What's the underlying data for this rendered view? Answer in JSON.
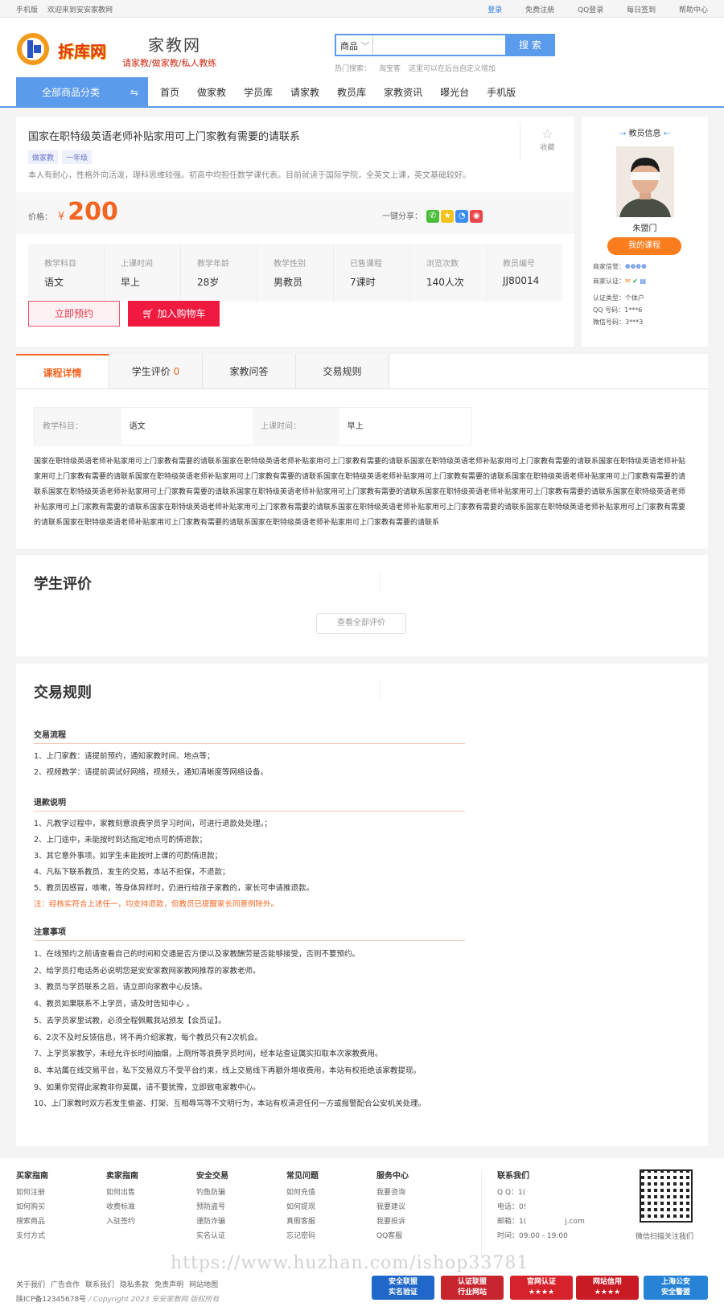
{
  "topbar": {
    "mobile": "手机版",
    "welcome": "欢迎来到安安家教网",
    "links": [
      "登录",
      "免费注册",
      "QQ登录",
      "每日签到",
      "帮助中心"
    ]
  },
  "header": {
    "logo": "拆库网",
    "brand": "家教网",
    "slogan": "请家教/做家教/私人教练"
  },
  "search": {
    "select": "商品",
    "button": "搜 索",
    "hot_label": "热门搜索：",
    "hot": [
      "淘宝客",
      "这里可以在后台自定义增加"
    ]
  },
  "nav": {
    "category": "全部商品分类",
    "items": [
      "首页",
      "做家教",
      "学员库",
      "请家教",
      "教员库",
      "家教资讯",
      "曝光台",
      "手机版"
    ]
  },
  "course": {
    "title": "国家在职特级英语老师补贴家用可上门家教有需要的请联系",
    "fav": "收藏",
    "tags": [
      "做家教",
      "一年级"
    ],
    "desc": "本人有耐心，性格外向活泼，理科思维较强。初高中均担任数学课代表。目前就读于国际学院，全英文上课，英文基础较好。",
    "price_label": "价格：",
    "currency": "¥",
    "price": "200",
    "share_label": "一键分享：",
    "attrs": [
      {
        "k": "教学科目",
        "v": "语文"
      },
      {
        "k": "上课时间",
        "v": "早上"
      },
      {
        "k": "教学年龄",
        "v": "28岁"
      },
      {
        "k": "教学性别",
        "v": "男教员"
      },
      {
        "k": "已售课程",
        "v": "7课时"
      },
      {
        "k": "浏览次数",
        "v": "140人次"
      },
      {
        "k": "教员编号",
        "v": "JJ80014"
      }
    ],
    "book": "立即预约",
    "cart": "加入购物车"
  },
  "teacher": {
    "header": "教员信息",
    "name": "朱盟门",
    "course_btn": "我的课程",
    "credit": "商家信誉：",
    "cert": "商家认证：",
    "type": "认证类型：个体户",
    "qq": "QQ 号码：1***6",
    "wechat": "微信号码：3***3"
  },
  "tabs": [
    {
      "label": "课程详情"
    },
    {
      "label": "学生评价",
      "count": "0"
    },
    {
      "label": "家教问答"
    },
    {
      "label": "交易规则"
    }
  ],
  "detail": {
    "k1": "教学科目：",
    "v1": "语文",
    "k2": "上课时间：",
    "v2": "早上",
    "text": "国家在职特级英语老师补贴家用可上门家教有需要的请联系国家在职特级英语老师补贴家用可上门家教有需要的请联系国家在职特级英语老师补贴家用可上门家教有需要的请联系国家在职特级英语老师补贴家用可上门家教有需要的请联系国家在职特级英语老师补贴家用可上门家教有需要的请联系国家在职特级英语老师补贴家用可上门家教有需要的请联系国家在职特级英语老师补贴家用可上门家教有需要的请联系国家在职特级英语老师补贴家用可上门家教有需要的请联系国家在职特级英语老师补贴家用可上门家教有需要的请联系国家在职特级英语老师补贴家用可上门家教有需要的请联系国家在职特级英语老师补贴家用可上门家教有需要的请联系国家在职特级英语老师补贴家用可上门家教有需要的请联系国家在职特级英语老师补贴家用可上门家教有需要的请联系国家在职特级英语老师补贴家用可上门家教有需要的请联系国家在职特级英语老师补贴家用可上门家教有需要的请联系国家在职特级英语老师补贴家用可上门家教有需要的请联系"
  },
  "reviews": {
    "title": "学生评价",
    "view_all": "查看全部评价"
  },
  "rules": {
    "title": "交易规则",
    "s1": "交易流程",
    "l1": [
      "1、上门家教：请提前预约，通知家教时间、地点等；",
      "2、视频教学：请提前调试好网络，视频头，通知清晰度等网络设备。"
    ],
    "s2": "退款说明",
    "l2": [
      "1、凡教学过程中，家教刻意浪费学员学习时间，可进行退款处处理。；",
      "2、上门途中，未能按时到达指定地点可酌情退款；",
      "3、其它意外事项，如学生未能按时上课的可酌情退款；",
      "4、凡私下联系教员，发生的交易，本站不担保，不退款；",
      "5、教员因感冒，咳嗽，等身体异样时，仍进行给孩子家教的，家长可申请推退款。"
    ],
    "note": "注：经核实符合上述任一，均支持退款，但教员已提醒家长同意例除外。",
    "s3": "注意事项",
    "l3": [
      "1、在线预约之前请查看自己的时间和交通是否方便以及家教酬劳是否能够接受，否则不要预约。",
      "2、给学员打电话务必说明您是安安家教网家教网推荐的家教老师。",
      "3、教员与学员联系之后，请立即向家教中心反馈。",
      "4、教员如果联系不上学员，请及时告知中心 。",
      "5、去学员家里试教，必须全程佩戴我站颁发【会员证】。",
      "6、2次不及时反馈信息，将不再介绍家教，每个教员只有2次机会。",
      "7、上学员家教学，未经允许长时间抽烟，上厕所等浪费学员时间，经本站查证属实扣取本次家教费用。",
      "8、本站属在线交易平台，私下交易双方不受平台约束，线上交易线下再额外增收费用，本站有权拒绝该家教提现。",
      "9、如果你觉得此家教非你莫属，请不要犹豫，立即致电家教中心。",
      "10、上门家教时双方若发生偷盗、打架、互相辱骂等不文明行为，本站有权清退任何一方或报警配合公安机关处理。"
    ]
  },
  "footer": {
    "cols": [
      {
        "h": "买家指南",
        "items": [
          "如何注册",
          "如何购买",
          "搜索商品",
          "支付方式"
        ]
      },
      {
        "h": "卖家指南",
        "items": [
          "如何出售",
          "收费标准",
          "入驻签约"
        ]
      },
      {
        "h": "安全交易",
        "items": [
          "钓鱼防骗",
          "预防盗号",
          "谨防诈骗",
          "实名认证"
        ]
      },
      {
        "h": "常见问题",
        "items": [
          "如何充值",
          "如何提现",
          "真假客服",
          "忘记密码"
        ]
      },
      {
        "h": "服务中心",
        "items": [
          "我要咨询",
          "我要建议",
          "我要投诉",
          "QQ客服"
        ]
      }
    ],
    "contact": {
      "h": "联系我们",
      "items": [
        "Q Q：1(",
        "电话：0!",
        "邮箱：1(",
        "时间：09:00 - 19:00"
      ],
      "extra": "j.com"
    },
    "qr_caption": "微信扫描关注我们",
    "links": [
      "关于我们",
      "广告合作",
      "联系我们",
      "隐私条款",
      "免责声明",
      "网站地图"
    ],
    "icp": "陕ICP备12345678号",
    "copyright": "/ Copyright 2023 安安家教网 版权所有",
    "badges": [
      "安全联盟\n实名验证",
      "认证联盟\n行业网站",
      "官网认证\n★★★★",
      "网站信用\n★★★★",
      "上海公安\n安全警盟"
    ]
  },
  "watermark": "https://www.huzhan.com/ishop33781"
}
